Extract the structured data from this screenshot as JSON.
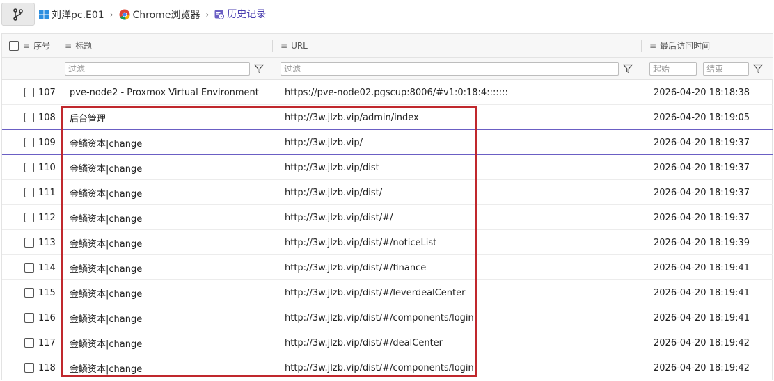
{
  "breadcrumb": {
    "items": [
      {
        "label": "刘洋pc.E01",
        "icon": "windows-icon"
      },
      {
        "label": "Chrome浏览器",
        "icon": "chrome-icon"
      },
      {
        "label": "历史记录",
        "icon": "history-icon"
      }
    ]
  },
  "table": {
    "headers": {
      "index": "序号",
      "title": "标题",
      "url": "URL",
      "last_visit": "最后访问时间"
    },
    "filters": {
      "title_placeholder": "过滤",
      "url_placeholder": "过滤",
      "start_placeholder": "起始",
      "end_placeholder": "结束"
    },
    "rows": [
      {
        "index": "107",
        "title": "pve-node2 - Proxmox Virtual Environment",
        "url": "https://pve-node02.pgscup:8006/#v1:0:18:4:::::::",
        "time": "2026-04-20 18:18:38"
      },
      {
        "index": "108",
        "title": "后台管理",
        "url": "http://3w.jlzb.vip/admin/index",
        "time": "2026-04-20 18:19:05"
      },
      {
        "index": "109",
        "title": "金鳞资本|change",
        "url": "http://3w.jlzb.vip/",
        "time": "2026-04-20 18:19:37"
      },
      {
        "index": "110",
        "title": "金鳞资本|change",
        "url": "http://3w.jlzb.vip/dist",
        "time": "2026-04-20 18:19:37"
      },
      {
        "index": "111",
        "title": "金鳞资本|change",
        "url": "http://3w.jlzb.vip/dist/",
        "time": "2026-04-20 18:19:37"
      },
      {
        "index": "112",
        "title": "金鳞资本|change",
        "url": "http://3w.jlzb.vip/dist/#/",
        "time": "2026-04-20 18:19:37"
      },
      {
        "index": "113",
        "title": "金鳞资本|change",
        "url": "http://3w.jlzb.vip/dist/#/noticeList",
        "time": "2026-04-20 18:19:39"
      },
      {
        "index": "114",
        "title": "金鳞资本|change",
        "url": "http://3w.jlzb.vip/dist/#/finance",
        "time": "2026-04-20 18:19:41"
      },
      {
        "index": "115",
        "title": "金鳞资本|change",
        "url": "http://3w.jlzb.vip/dist/#/leverdealCenter",
        "time": "2026-04-20 18:19:41"
      },
      {
        "index": "116",
        "title": "金鳞资本|change",
        "url": "http://3w.jlzb.vip/dist/#/components/login",
        "time": "2026-04-20 18:19:41"
      },
      {
        "index": "117",
        "title": "金鳞资本|change",
        "url": "http://3w.jlzb.vip/dist/#/dealCenter",
        "time": "2026-04-20 18:19:42"
      },
      {
        "index": "118",
        "title": "金鳞资本|change",
        "url": "http://3w.jlzb.vip/dist/#/components/login",
        "time": "2026-04-20 18:19:42"
      }
    ]
  },
  "colors": {
    "accent": "#4b3fb0",
    "highlight_box": "#c0282d",
    "selection_line": "#6b5fc4"
  }
}
